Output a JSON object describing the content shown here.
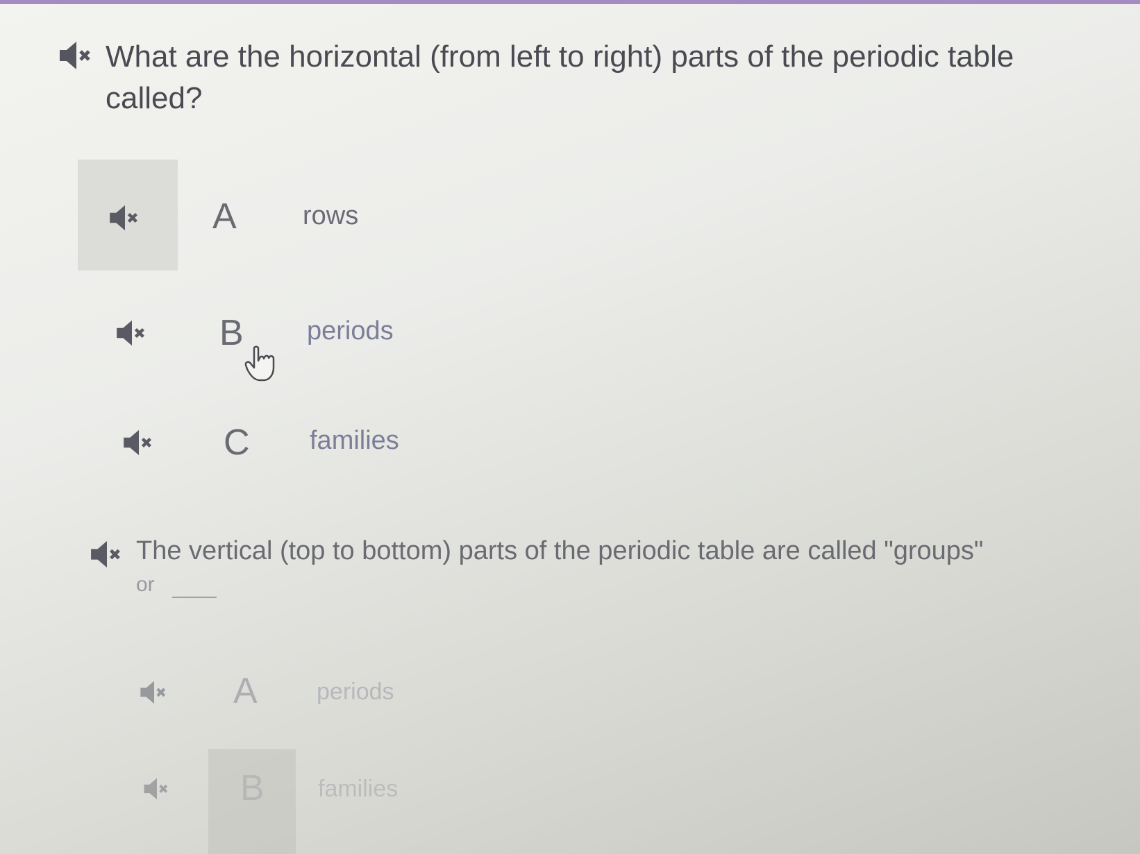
{
  "question1": {
    "text_line1": "What are the horizontal (from left to right) parts of the periodic table",
    "text_line2": "called?",
    "options": [
      {
        "letter": "A",
        "text": "rows"
      },
      {
        "letter": "B",
        "text": "periods"
      },
      {
        "letter": "C",
        "text": "families"
      }
    ]
  },
  "question2": {
    "text_line1": "The vertical (top to bottom) parts of the periodic table are called \"groups\"",
    "text_line2": "or",
    "options": [
      {
        "letter": "A",
        "text": "periods"
      },
      {
        "letter": "B",
        "text": "families"
      }
    ]
  },
  "icons": {
    "speaker": "speaker-muted-icon",
    "cursor": "hand-pointer-icon"
  },
  "colors": {
    "top_border": "#a48bc4",
    "selected_cell": "#dcdcd9",
    "text": "#4a4a52"
  }
}
